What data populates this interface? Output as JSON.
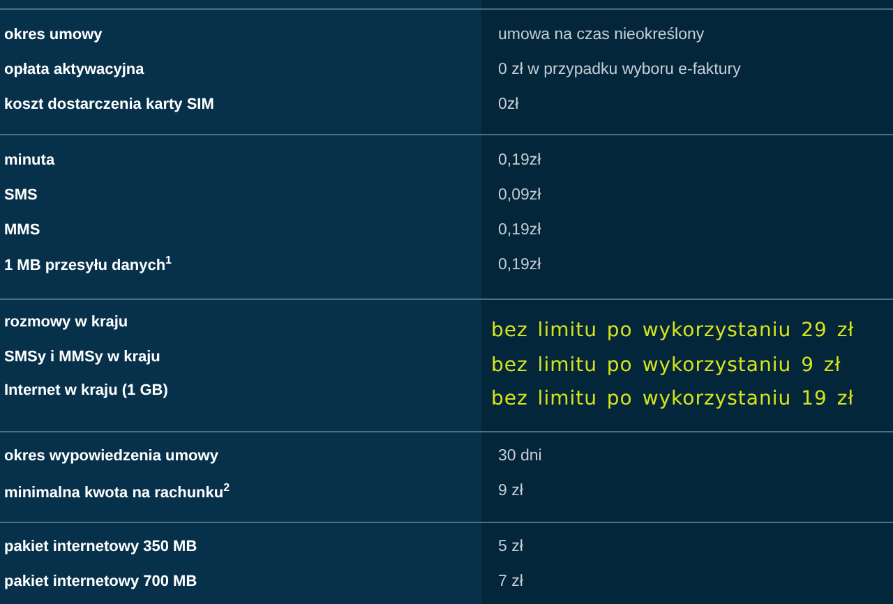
{
  "sections": [
    {
      "kind": "plain",
      "rows": [
        {
          "label": "okres umowy",
          "value": "umowa na czas nieokreślony"
        },
        {
          "label": "opłata aktywacyjna",
          "value": "0 zł w przypadku wyboru e-faktury"
        },
        {
          "label": "koszt dostarczenia karty SIM",
          "value": "0zł"
        }
      ]
    },
    {
      "kind": "plain",
      "rows": [
        {
          "label": "minuta",
          "value": "0,19zł"
        },
        {
          "label": "SMS",
          "value": "0,09zł"
        },
        {
          "label": "MMS",
          "value": "0,19zł"
        },
        {
          "label": "1 MB przesyłu danych$^{1}$",
          "value": "0,19zł"
        }
      ]
    },
    {
      "kind": "highlight",
      "rows": [
        {
          "label": "rozmowy w kraju",
          "value": "bez limitu po wykorzystaniu 29 zł"
        },
        {
          "label": "SMSy i MMSy w kraju",
          "value": "bez limitu po wykorzystaniu 9 zł"
        },
        {
          "label": "Internet w kraju (1 GB)",
          "value": "bez limitu po wykorzystaniu 19 zł"
        }
      ]
    },
    {
      "kind": "plain",
      "rows": [
        {
          "label": "okres wypowiedzenia umowy",
          "value": "30 dni"
        },
        {
          "label": "minimalna kwota na rachunku$^{2}$",
          "value": "9 zł"
        }
      ]
    },
    {
      "kind": "plain",
      "rows": [
        {
          "label": "pakiet internetowy 350 MB",
          "value": "5 zł"
        },
        {
          "label": "pakiet internetowy 700 MB",
          "value": "7 zł"
        }
      ]
    }
  ]
}
